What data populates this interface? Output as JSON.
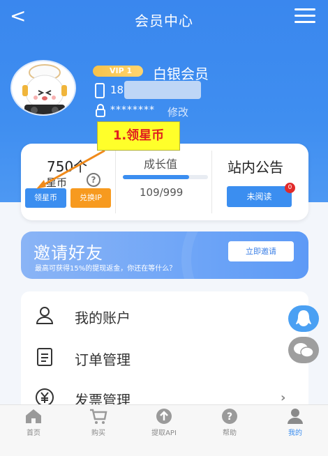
{
  "header": {
    "title": "会员中心",
    "back_glyph": "<"
  },
  "profile": {
    "vip_badge": "VIP 1",
    "level_name": "白银会员",
    "phone_visible": "18",
    "password_mask": "********",
    "edit_label": "修改"
  },
  "stats": {
    "coins_amount": "750个",
    "coins_label": "星币",
    "help_glyph": "?",
    "claim_button": "领星币",
    "exchange_button": "兑换IP",
    "growth_label": "成长值",
    "growth_value": "109/999",
    "growth_current": 109,
    "growth_max": 999,
    "notice_title": "站内公告",
    "unread_button": "未阅读",
    "unread_count": "0"
  },
  "annotation": {
    "callout_text": "1.领星币"
  },
  "invite": {
    "title": "邀请好友",
    "subtitle": "最高可获得15%的提现返金，你还在等什么？",
    "button": "立即邀请"
  },
  "menu_list": [
    {
      "label": "我的账户",
      "icon": "user-icon"
    },
    {
      "label": "订单管理",
      "icon": "order-icon"
    },
    {
      "label": "发票管理",
      "icon": "yuan-icon"
    }
  ],
  "floating": {
    "qq_icon": "qq-icon",
    "wechat_icon": "wechat-icon"
  },
  "tabbar": [
    {
      "label": "首页",
      "icon": "home-icon",
      "active": false
    },
    {
      "label": "购买",
      "icon": "cart-icon",
      "active": false
    },
    {
      "label": "提取API",
      "icon": "upload-icon",
      "active": false
    },
    {
      "label": "帮助",
      "icon": "help-icon",
      "active": false
    },
    {
      "label": "我的",
      "icon": "profile-icon",
      "active": true
    }
  ],
  "colors": {
    "primary": "#3b8ef0",
    "accent_orange": "#f79a1f",
    "callout_yellow": "#ffff2a",
    "callout_text": "#e01f1f",
    "badge_red": "#e12a2a"
  }
}
